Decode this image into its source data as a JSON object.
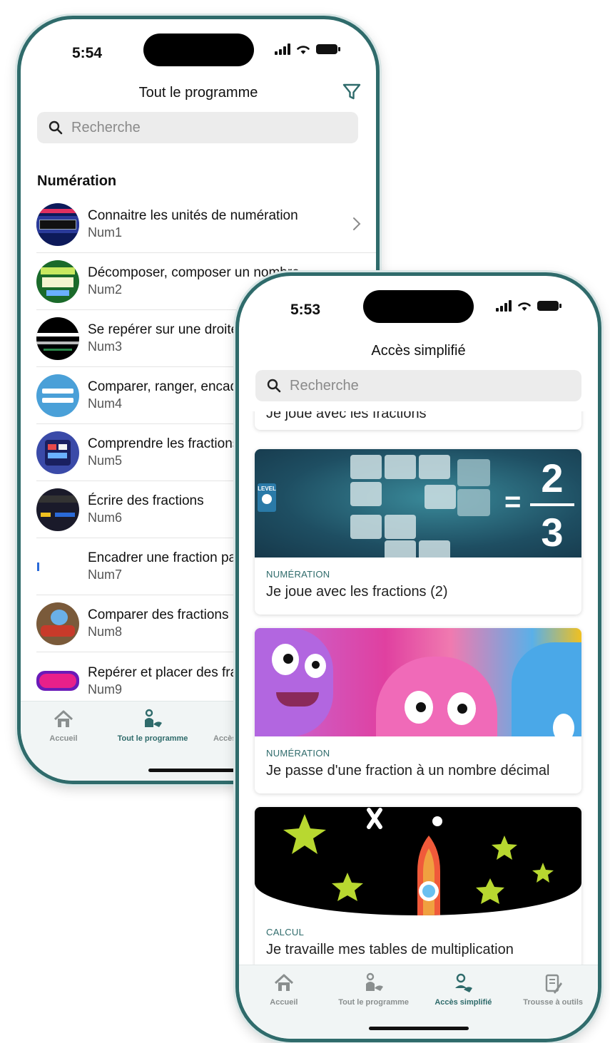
{
  "colors": {
    "accent": "#2f6b6b",
    "tab_inactive": "#8a8f8f"
  },
  "phone_left": {
    "time": "5:54",
    "header_title": "Tout le programme",
    "search_placeholder": "Recherche",
    "section_title": "Numération",
    "items": [
      {
        "title": "Connaitre les unités de numération",
        "code": "Num1"
      },
      {
        "title": "Décomposer, composer un nombre",
        "code": "Num2"
      },
      {
        "title": "Se repérer sur une droite",
        "code": "Num3"
      },
      {
        "title": "Comparer, ranger, encadrer",
        "code": "Num4"
      },
      {
        "title": "Comprendre les fractions",
        "code": "Num5"
      },
      {
        "title": "Écrire des fractions",
        "code": "Num6"
      },
      {
        "title": "Encadrer une fraction par",
        "code": "Num7"
      },
      {
        "title": "Comparer des fractions",
        "code": "Num8"
      },
      {
        "title": "Repérer et placer des fractions",
        "code": "Num9"
      }
    ],
    "tabs": [
      {
        "label": "Accueil",
        "icon": "home-icon"
      },
      {
        "label": "Tout le programme",
        "icon": "program-icon"
      },
      {
        "label": "Accès simplifié",
        "icon": "simplified-access-icon"
      }
    ]
  },
  "phone_right": {
    "time": "5:53",
    "header_title": "Accès simplifié",
    "search_placeholder": "Recherche",
    "partial_card_title": "Je joue avec les fractions",
    "cards": [
      {
        "category": "NUMÉRATION",
        "title": "Je joue avec les fractions (2)",
        "image_text": {
          "level": "LEVEL",
          "numerator": "2",
          "denominator": "3",
          "equals": "="
        }
      },
      {
        "category": "NUMÉRATION",
        "title": "Je passe d'une fraction à un nombre décimal"
      },
      {
        "category": "CALCUL",
        "title": "Je travaille mes tables de multiplication"
      }
    ],
    "tabs": [
      {
        "label": "Accueil",
        "icon": "home-icon"
      },
      {
        "label": "Tout le programme",
        "icon": "program-icon"
      },
      {
        "label": "Accès simplifié",
        "icon": "simplified-access-icon"
      },
      {
        "label": "Trousse à outils",
        "icon": "toolbox-icon"
      }
    ]
  }
}
